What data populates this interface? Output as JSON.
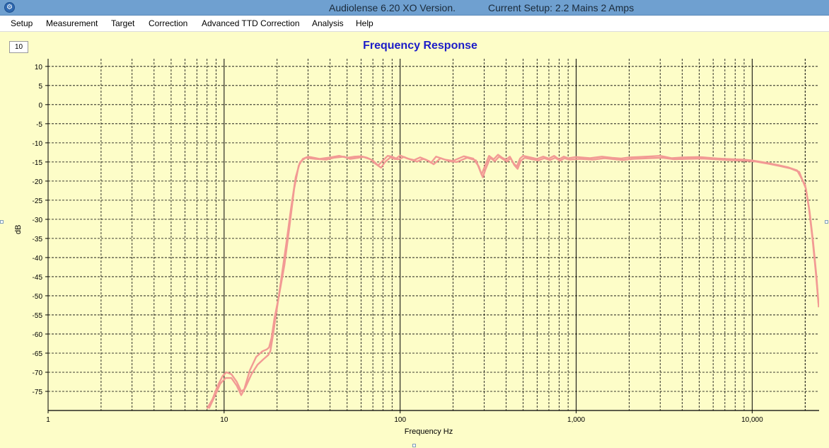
{
  "window": {
    "title": "Audiolense 6.20 XO Version.",
    "setup": "Current Setup: 2.2 Mains 2 Amps"
  },
  "menu": {
    "items": [
      {
        "id": "setup",
        "label": "Setup"
      },
      {
        "id": "measurement",
        "label": "Measurement"
      },
      {
        "id": "target",
        "label": "Target"
      },
      {
        "id": "correction",
        "label": "Correction"
      },
      {
        "id": "advanced-ttd-correction",
        "label": "Advanced TTD Correction"
      },
      {
        "id": "analysis",
        "label": "Analysis"
      },
      {
        "id": "help",
        "label": "Help"
      }
    ]
  },
  "zoom_value": "10",
  "chart_data": {
    "type": "line",
    "title": "Frequency Response",
    "xlabel": "Frequency Hz",
    "ylabel": "dB",
    "x_scale": "log",
    "xlim": [
      1,
      24000
    ],
    "ylim": [
      -80,
      12
    ],
    "x_tick_labels": [
      {
        "value": 1,
        "label": "1"
      },
      {
        "value": 10,
        "label": "10"
      },
      {
        "value": 100,
        "label": "100"
      },
      {
        "value": 1000,
        "label": "1,000"
      },
      {
        "value": 10000,
        "label": "10,000"
      }
    ],
    "y_ticks": [
      10,
      5,
      0,
      -5,
      -10,
      -15,
      -20,
      -25,
      -30,
      -35,
      -40,
      -45,
      -50,
      -55,
      -60,
      -65,
      -70,
      -75
    ],
    "grid": true,
    "legend": "none",
    "line_color": "#f29a94",
    "series": [
      {
        "points": [
          [
            8,
            -79.5
          ],
          [
            8.6,
            -77
          ],
          [
            9.2,
            -73.5
          ],
          [
            9.8,
            -71
          ],
          [
            10.3,
            -70
          ],
          [
            11,
            -70.5
          ],
          [
            11.8,
            -72.5
          ],
          [
            12.5,
            -75
          ],
          [
            13,
            -74.5
          ],
          [
            14,
            -69.5
          ],
          [
            15.2,
            -66
          ],
          [
            16.5,
            -64.5
          ],
          [
            17.5,
            -64
          ],
          [
            18,
            -63.5
          ],
          [
            18.6,
            -61
          ],
          [
            19.3,
            -56
          ],
          [
            20.5,
            -50
          ],
          [
            22,
            -42
          ],
          [
            23.5,
            -32
          ],
          [
            25,
            -22
          ],
          [
            26.5,
            -16
          ],
          [
            28,
            -14.2
          ],
          [
            30,
            -13.6
          ],
          [
            35,
            -14.2
          ],
          [
            40,
            -13.8
          ],
          [
            45,
            -13.4
          ],
          [
            50,
            -13.9
          ],
          [
            55,
            -13.6
          ],
          [
            60,
            -13.5
          ],
          [
            65,
            -13.9
          ],
          [
            70,
            -14.6
          ],
          [
            75,
            -15.9
          ],
          [
            80,
            -14.6
          ],
          [
            85,
            -13.4
          ],
          [
            90,
            -13.6
          ],
          [
            95,
            -14.1
          ],
          [
            100,
            -13.3
          ],
          [
            110,
            -14.1
          ],
          [
            120,
            -14.5
          ],
          [
            130,
            -13.8
          ],
          [
            140,
            -14.4
          ],
          [
            150,
            -15.2
          ],
          [
            160,
            -13.6
          ],
          [
            180,
            -14.4
          ],
          [
            200,
            -14.7
          ],
          [
            230,
            -13.5
          ],
          [
            260,
            -14.1
          ],
          [
            280,
            -16.2
          ],
          [
            290,
            -18.3
          ],
          [
            300,
            -16.6
          ],
          [
            320,
            -13.4
          ],
          [
            340,
            -14.3
          ],
          [
            360,
            -13.1
          ],
          [
            380,
            -13.9
          ],
          [
            400,
            -14.4
          ],
          [
            420,
            -13.6
          ],
          [
            440,
            -15.3
          ],
          [
            460,
            -16.2
          ],
          [
            480,
            -14.1
          ],
          [
            500,
            -13.4
          ],
          [
            550,
            -13.8
          ],
          [
            600,
            -14.2
          ],
          [
            650,
            -13.6
          ],
          [
            700,
            -14.1
          ],
          [
            750,
            -13.4
          ],
          [
            800,
            -14.3
          ],
          [
            850,
            -13.6
          ],
          [
            900,
            -14.0
          ],
          [
            1000,
            -13.7
          ],
          [
            1200,
            -14.0
          ],
          [
            1400,
            -13.6
          ],
          [
            1600,
            -13.9
          ],
          [
            1800,
            -14.1
          ],
          [
            2000,
            -13.8
          ],
          [
            2500,
            -13.6
          ],
          [
            3000,
            -13.4
          ],
          [
            3500,
            -14.0
          ],
          [
            4000,
            -13.8
          ],
          [
            5000,
            -13.7
          ],
          [
            6000,
            -14.0
          ],
          [
            7000,
            -14.2
          ],
          [
            8000,
            -14.3
          ],
          [
            9000,
            -14.4
          ],
          [
            10000,
            -14.6
          ],
          [
            12000,
            -15.2
          ],
          [
            14000,
            -15.8
          ],
          [
            16000,
            -16.4
          ],
          [
            18000,
            -17.2
          ],
          [
            20000,
            -21
          ],
          [
            21000,
            -27
          ],
          [
            22000,
            -35
          ],
          [
            23000,
            -44
          ],
          [
            23800,
            -52
          ]
        ]
      },
      {
        "points": [
          [
            8.2,
            -79.5
          ],
          [
            8.9,
            -76
          ],
          [
            9.5,
            -73
          ],
          [
            10.2,
            -71.5
          ],
          [
            11,
            -71.5
          ],
          [
            11.8,
            -73.5
          ],
          [
            12.5,
            -76
          ],
          [
            13.2,
            -74
          ],
          [
            14.3,
            -70.5
          ],
          [
            15.5,
            -68
          ],
          [
            16.8,
            -66.5
          ],
          [
            17.8,
            -65.5
          ],
          [
            18.3,
            -64.5
          ],
          [
            19,
            -60
          ],
          [
            20,
            -53
          ],
          [
            21.2,
            -45
          ],
          [
            22.6,
            -36
          ],
          [
            24,
            -27
          ],
          [
            25.5,
            -19
          ],
          [
            27,
            -15
          ],
          [
            29,
            -13.9
          ],
          [
            33,
            -14.2
          ],
          [
            38,
            -14.4
          ],
          [
            42,
            -13.9
          ],
          [
            48,
            -13.6
          ],
          [
            52,
            -14.2
          ],
          [
            58,
            -13.9
          ],
          [
            62,
            -13.7
          ],
          [
            68,
            -14.3
          ],
          [
            72,
            -15.4
          ],
          [
            78,
            -16.5
          ],
          [
            82,
            -15.0
          ],
          [
            88,
            -13.8
          ],
          [
            92,
            -14.2
          ],
          [
            98,
            -14.3
          ],
          [
            105,
            -13.7
          ],
          [
            115,
            -14.4
          ],
          [
            125,
            -14.9
          ],
          [
            135,
            -14.2
          ],
          [
            145,
            -14.7
          ],
          [
            155,
            -15.6
          ],
          [
            170,
            -14.0
          ],
          [
            190,
            -14.8
          ],
          [
            210,
            -15.0
          ],
          [
            240,
            -13.9
          ],
          [
            270,
            -14.6
          ],
          [
            285,
            -17.4
          ],
          [
            295,
            -19.0
          ],
          [
            305,
            -17.0
          ],
          [
            325,
            -13.9
          ],
          [
            345,
            -14.8
          ],
          [
            365,
            -13.6
          ],
          [
            385,
            -14.3
          ],
          [
            405,
            -14.9
          ],
          [
            425,
            -14.0
          ],
          [
            445,
            -15.8
          ],
          [
            465,
            -16.8
          ],
          [
            485,
            -14.7
          ],
          [
            510,
            -13.9
          ],
          [
            560,
            -14.3
          ],
          [
            610,
            -14.6
          ],
          [
            660,
            -14.0
          ],
          [
            710,
            -14.5
          ],
          [
            760,
            -13.9
          ],
          [
            810,
            -14.7
          ],
          [
            860,
            -14.0
          ],
          [
            910,
            -14.4
          ],
          [
            1050,
            -14.2
          ],
          [
            1250,
            -14.4
          ],
          [
            1450,
            -14.0
          ],
          [
            1650,
            -14.3
          ],
          [
            1850,
            -14.5
          ],
          [
            2100,
            -14.2
          ],
          [
            2600,
            -14.0
          ],
          [
            3100,
            -13.9
          ],
          [
            3600,
            -14.3
          ],
          [
            4200,
            -14.2
          ],
          [
            5200,
            -14.1
          ],
          [
            6200,
            -14.3
          ],
          [
            7200,
            -14.5
          ],
          [
            8200,
            -14.6
          ],
          [
            9200,
            -14.7
          ],
          [
            10500,
            -14.9
          ],
          [
            12500,
            -15.5
          ],
          [
            14500,
            -16.1
          ],
          [
            16500,
            -16.7
          ],
          [
            18500,
            -17.6
          ],
          [
            20200,
            -22
          ],
          [
            21200,
            -28
          ],
          [
            22200,
            -36
          ],
          [
            23200,
            -45
          ],
          [
            23900,
            -53
          ]
        ]
      }
    ]
  }
}
